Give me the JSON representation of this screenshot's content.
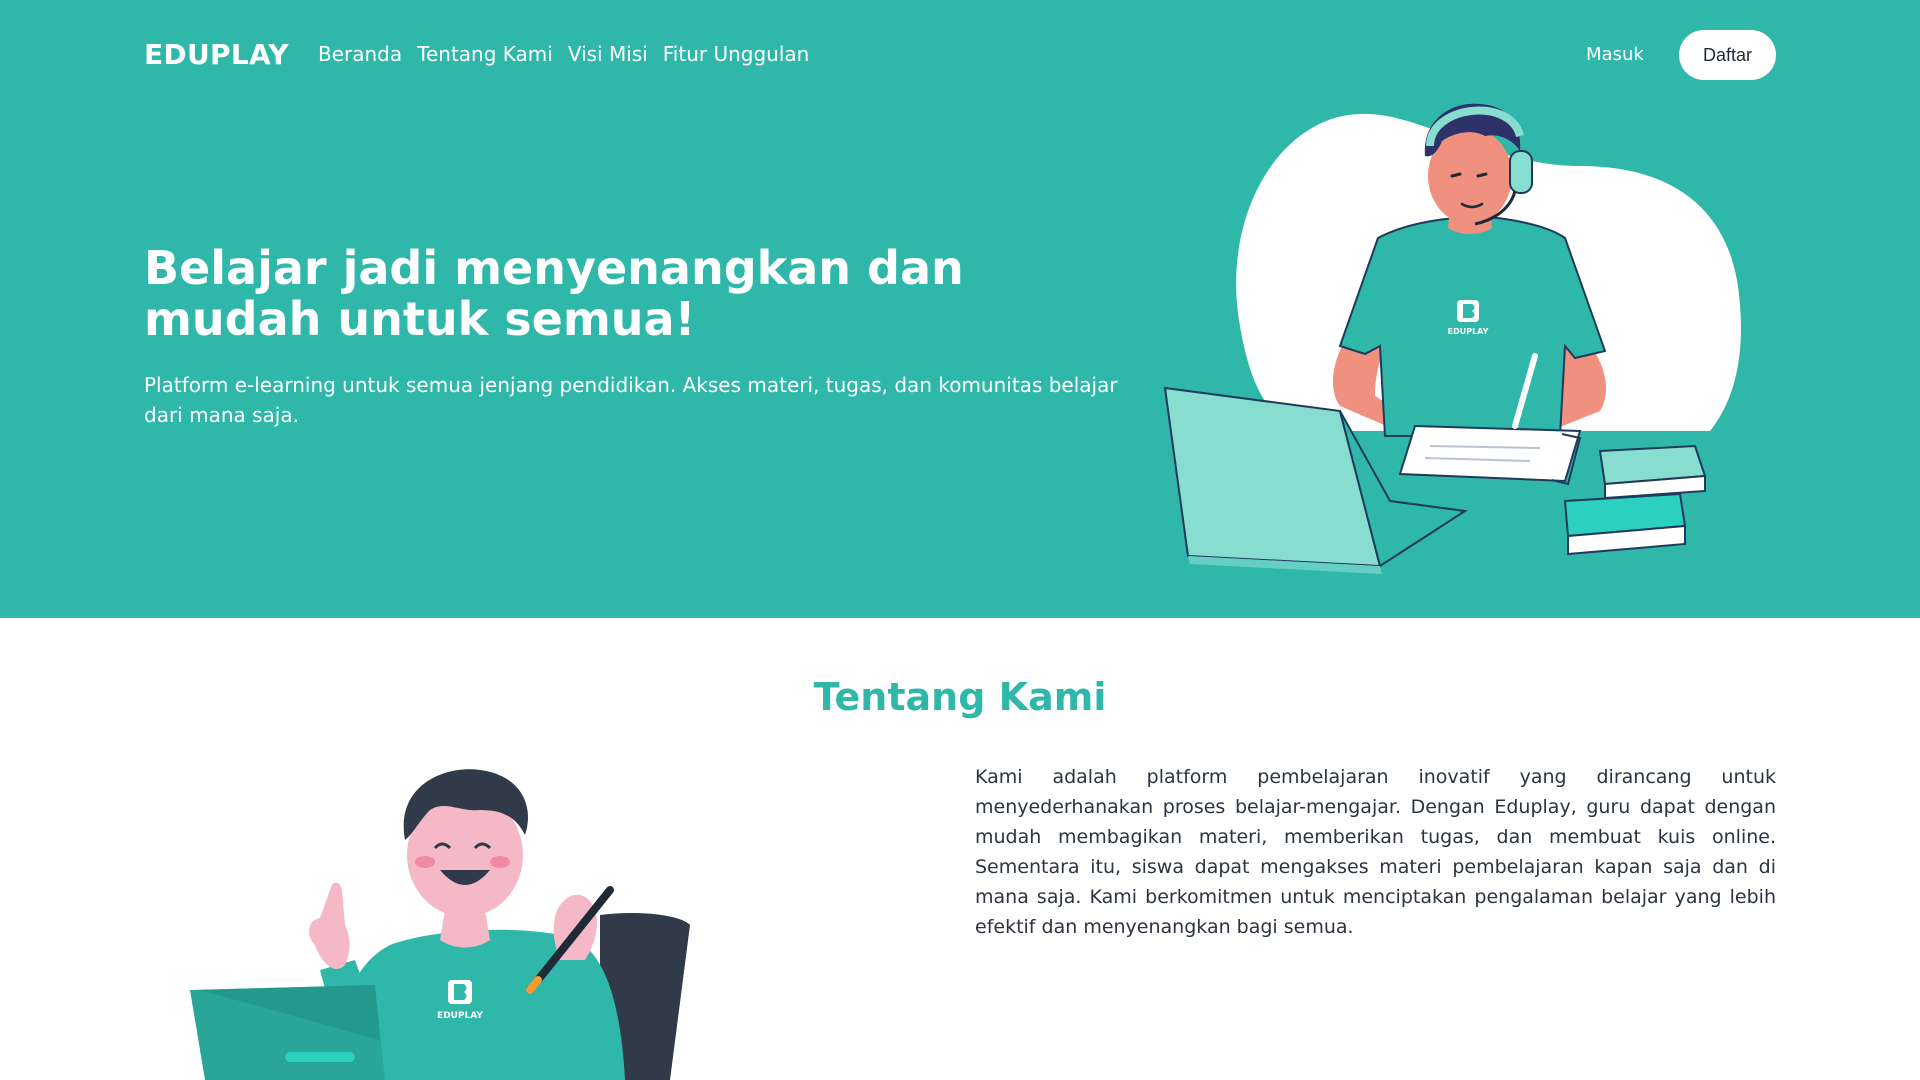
{
  "header": {
    "brand": "EDUPLAY",
    "nav": [
      "Beranda",
      "Tentang Kami",
      "Visi Misi",
      "Fitur Unggulan"
    ],
    "login_label": "Masuk",
    "register_label": "Daftar"
  },
  "hero": {
    "title": "Belajar jadi menyenangkan dan mudah untuk semua!",
    "subtitle": "Platform e-learning untuk semua jenjang pendidikan. Akses materi, tugas, dan komunitas belajar dari mana saja.",
    "shirt_logo_text": "EDUPLAY"
  },
  "about": {
    "title": "Tentang Kami",
    "text": "Kami adalah platform pembelajaran inovatif yang dirancang untuk menyederhanakan proses belajar-mengajar. Dengan Eduplay, guru dapat dengan mudah membagikan materi, memberikan tugas, dan membuat kuis online. Sementara itu, siswa dapat mengakses materi pembelajaran kapan saja dan di mana saja. Kami berkomitmen untuk menciptakan pengalaman belajar yang lebih efektif dan menyenangkan bagi semua.",
    "shirt_logo_text": "EDUPLAY"
  },
  "colors": {
    "primary": "#2fb8aa",
    "text_dark": "#2b3440",
    "white": "#ffffff"
  }
}
